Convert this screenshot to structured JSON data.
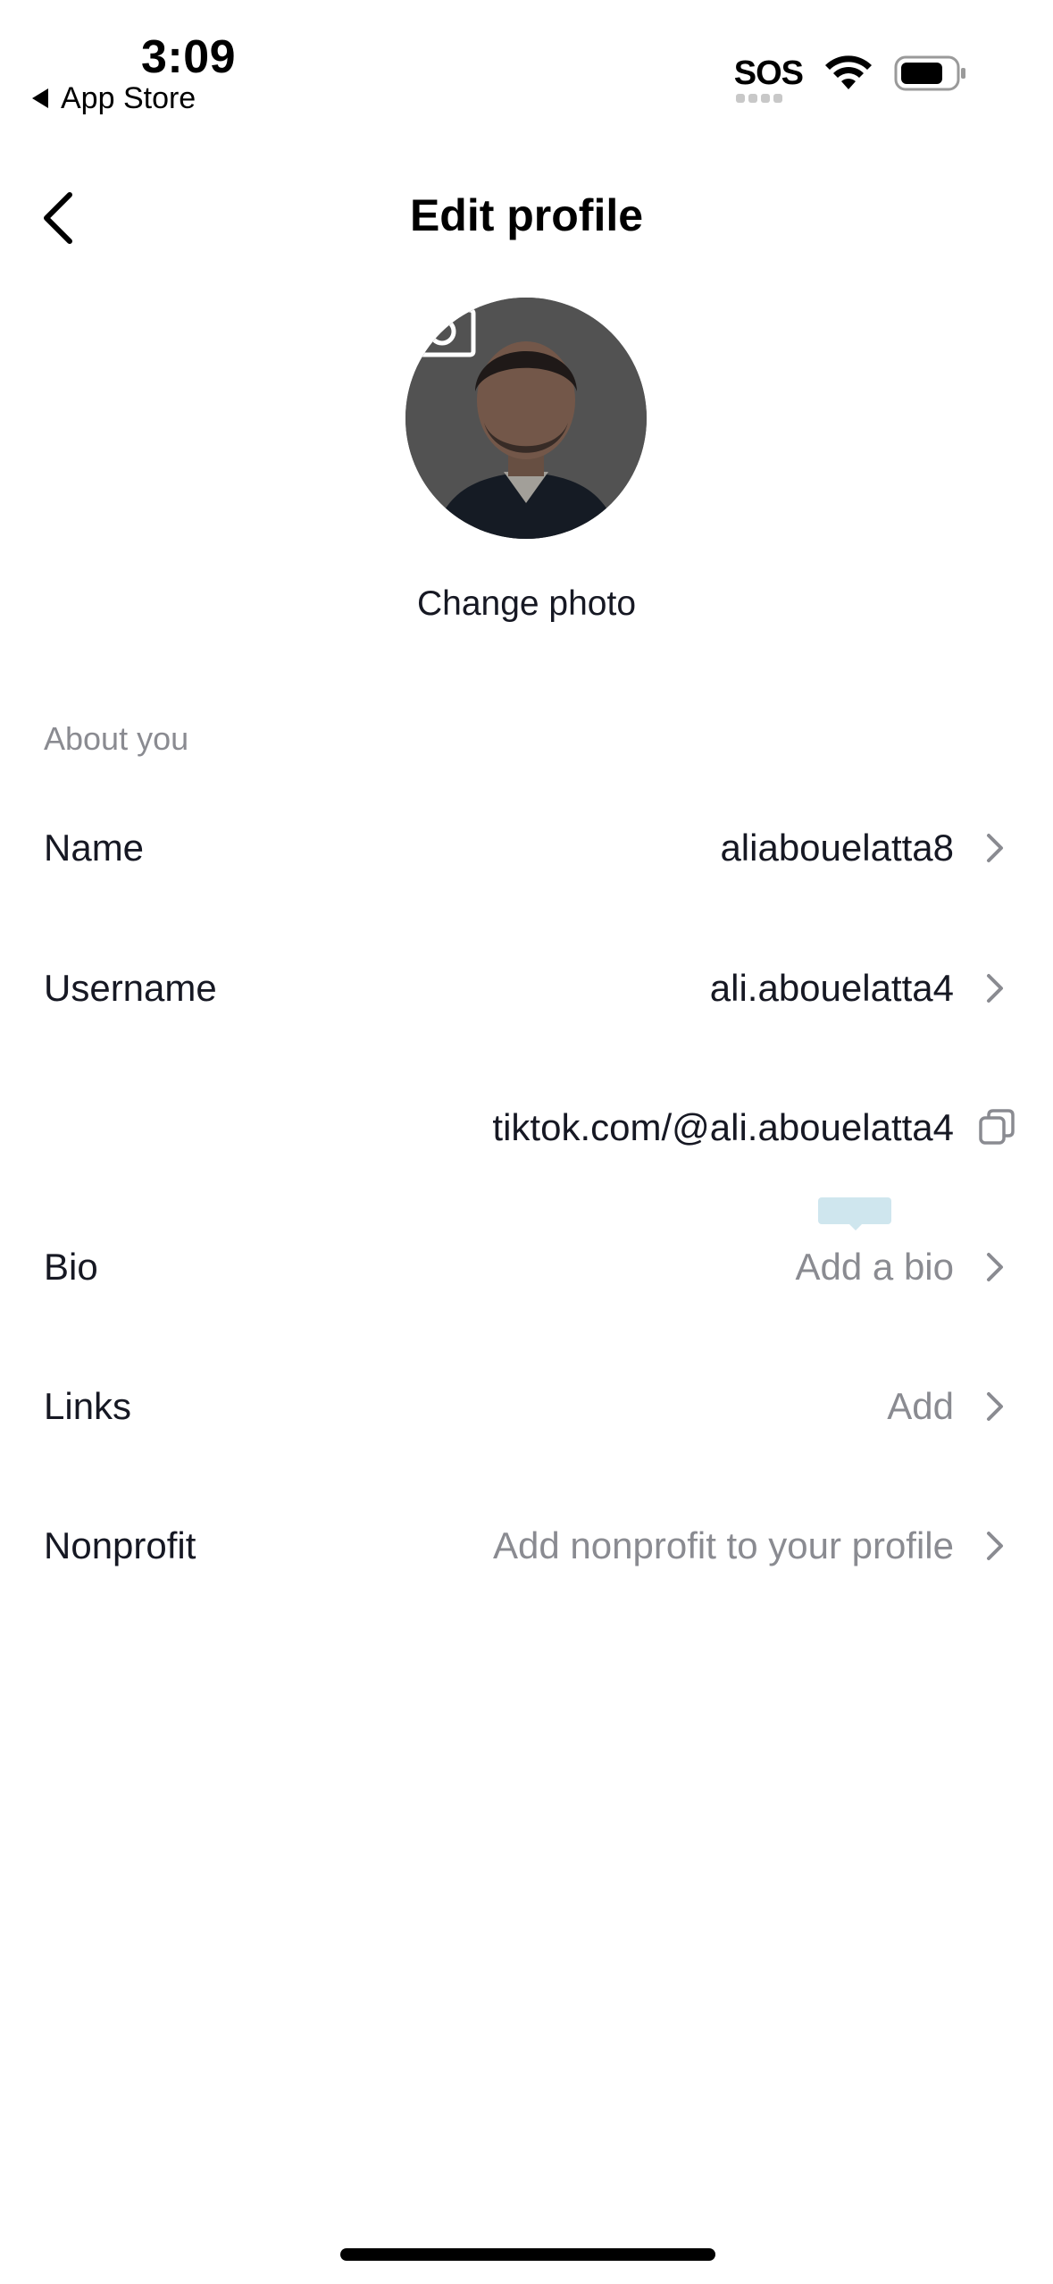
{
  "status_bar": {
    "time": "3:09",
    "back_app": "App Store",
    "carrier": "SOS",
    "wifi_icon": "wifi-icon",
    "battery_icon": "battery-icon"
  },
  "header": {
    "title": "Edit profile",
    "back_icon": "chevron-left-icon"
  },
  "avatar": {
    "change_photo_label": "Change photo",
    "camera_icon": "camera-icon"
  },
  "section": {
    "heading": "About you"
  },
  "rows": {
    "name": {
      "label": "Name",
      "value": "aliabouelatta8"
    },
    "username": {
      "label": "Username",
      "value": "ali.abouelatta4"
    },
    "profile_link": {
      "value": "tiktok.com/@ali.abouelatta4",
      "icon": "copy-icon"
    },
    "bio": {
      "label": "Bio",
      "value": "Add a bio"
    },
    "links": {
      "label": "Links",
      "value": "Add"
    },
    "nonprofit": {
      "label": "Nonprofit",
      "value": "Add nonprofit to your profile"
    }
  },
  "colors": {
    "text_primary": "#161823",
    "text_secondary": "#8a8b91",
    "background": "#ffffff",
    "tooltip": "#cfe6ee"
  }
}
